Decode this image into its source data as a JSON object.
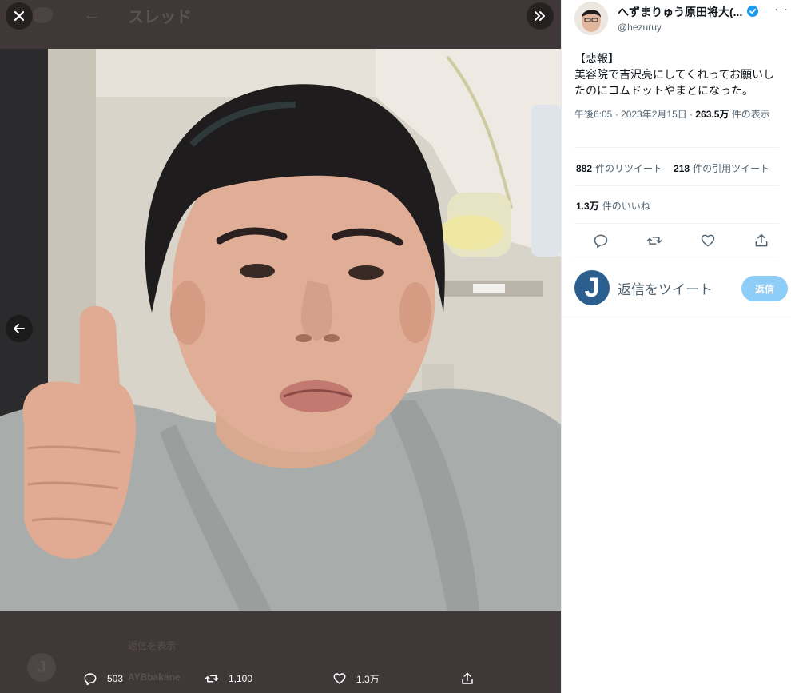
{
  "background_thread": {
    "header_title": "スレッド",
    "back_glyph": "←",
    "ghost_line": "返信を表示",
    "ghost_author": "AYBbakane",
    "ghost_avatar_letter": "J"
  },
  "viewer": {
    "close_icon": "close-icon",
    "expand_icon": "double-chevron-right-icon",
    "prev_icon": "arrow-left-icon",
    "actions": {
      "reply_count": "503",
      "retweet_count": "1,100",
      "like_count": "1.3万"
    }
  },
  "tweet": {
    "display_name": "へずまりゅう原田将大(...",
    "handle": "@hezuruy",
    "text_line1": "【悲報】",
    "text_line2": "美容院で吉沢亮にしてくれってお願いしたのにコムドットやまとになった。",
    "time": "午後6:05 · 2023年2月15日 · ",
    "views_count": "263.5万",
    "views_label": " 件の表示",
    "retweets_count": "882",
    "retweets_label": "件のリツイート",
    "quotes_count": "218",
    "quotes_label": "件の引用ツイート",
    "likes_count": "1.3万",
    "likes_label": "件のいいね"
  },
  "reply_box": {
    "avatar_letter": "J",
    "placeholder": "返信をツイート",
    "button_label": "返信"
  },
  "colors": {
    "accent": "#1d9bf0",
    "reply_button_disabled": "#8ecdf8",
    "viewer_bg": "#403838"
  }
}
